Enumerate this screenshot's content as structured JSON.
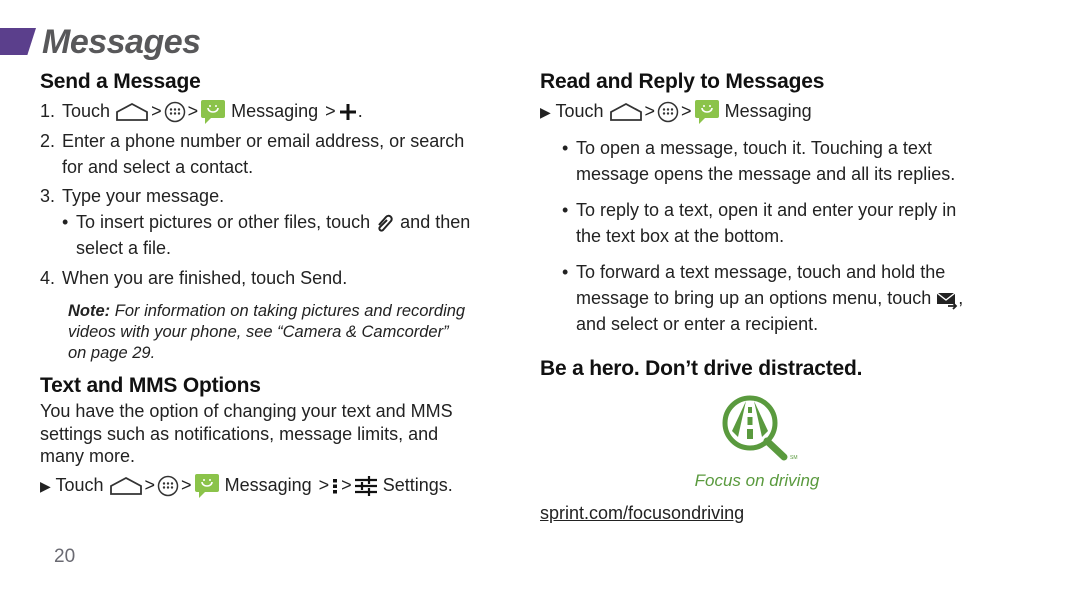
{
  "header": {
    "title": "Messages"
  },
  "left": {
    "send": {
      "heading": "Send a Message",
      "step1": {
        "num": "1.",
        "touch": "Touch",
        "gt": ">",
        "messaging": "Messaging",
        "end": "."
      },
      "step2": {
        "num": "2.",
        "line1": "Enter a phone number or email address, or search",
        "line2": "for and select a contact."
      },
      "step3": {
        "num": "3.",
        "text": "Type your message."
      },
      "step3_bullet": {
        "before": "To insert pictures or other files, touch",
        "after": "and then",
        "line2": "select a file."
      },
      "step4": {
        "num": "4.",
        "text": "When you are finished, touch ",
        "bold": "Send",
        "end": "."
      },
      "note": {
        "label": "Note:",
        "line1": " For information on taking pictures and recording",
        "line2": "videos with your phone, see “Camera & Camcorder”",
        "line3": "on page 29."
      }
    },
    "options": {
      "heading": "Text and MMS Options",
      "line1": "You have the option of changing your text and MMS",
      "line2": "settings such as notifications, message limits, and",
      "line3": "many more.",
      "instruction": {
        "arrow": "▶",
        "touch": "Touch",
        "gt": ">",
        "messaging": "Messaging",
        "settings": "Settings."
      }
    }
  },
  "right": {
    "read": {
      "heading": "Read and Reply to Messages",
      "instruction": {
        "arrow": "▶",
        "touch": "Touch",
        "gt": ">",
        "messaging": "Messaging"
      },
      "bullets": [
        {
          "line1": "To open a message, touch it. Touching a text",
          "line2": "message opens the message and all its replies."
        },
        {
          "line1": "To reply to a text, open it and enter your reply in",
          "line2": "the text box at the bottom."
        },
        {
          "line1": "To forward a text message, touch and hold the",
          "line2a": "message to bring up an options menu, touch",
          "line2b": ",",
          "line3": "and select or enter a recipient."
        }
      ]
    },
    "hero": {
      "heading": "Be a hero. Don’t drive distracted.",
      "tagline": "Focus on driving",
      "link": "sprint.com/focusondriving",
      "tm": "SM"
    }
  },
  "footer": {
    "page_number": "20"
  },
  "colors": {
    "accent_purple": "#5b3f8c",
    "title_gray": "#58585a",
    "brand_green": "#5a9a3e",
    "messaging_green": "#8bc34a"
  }
}
